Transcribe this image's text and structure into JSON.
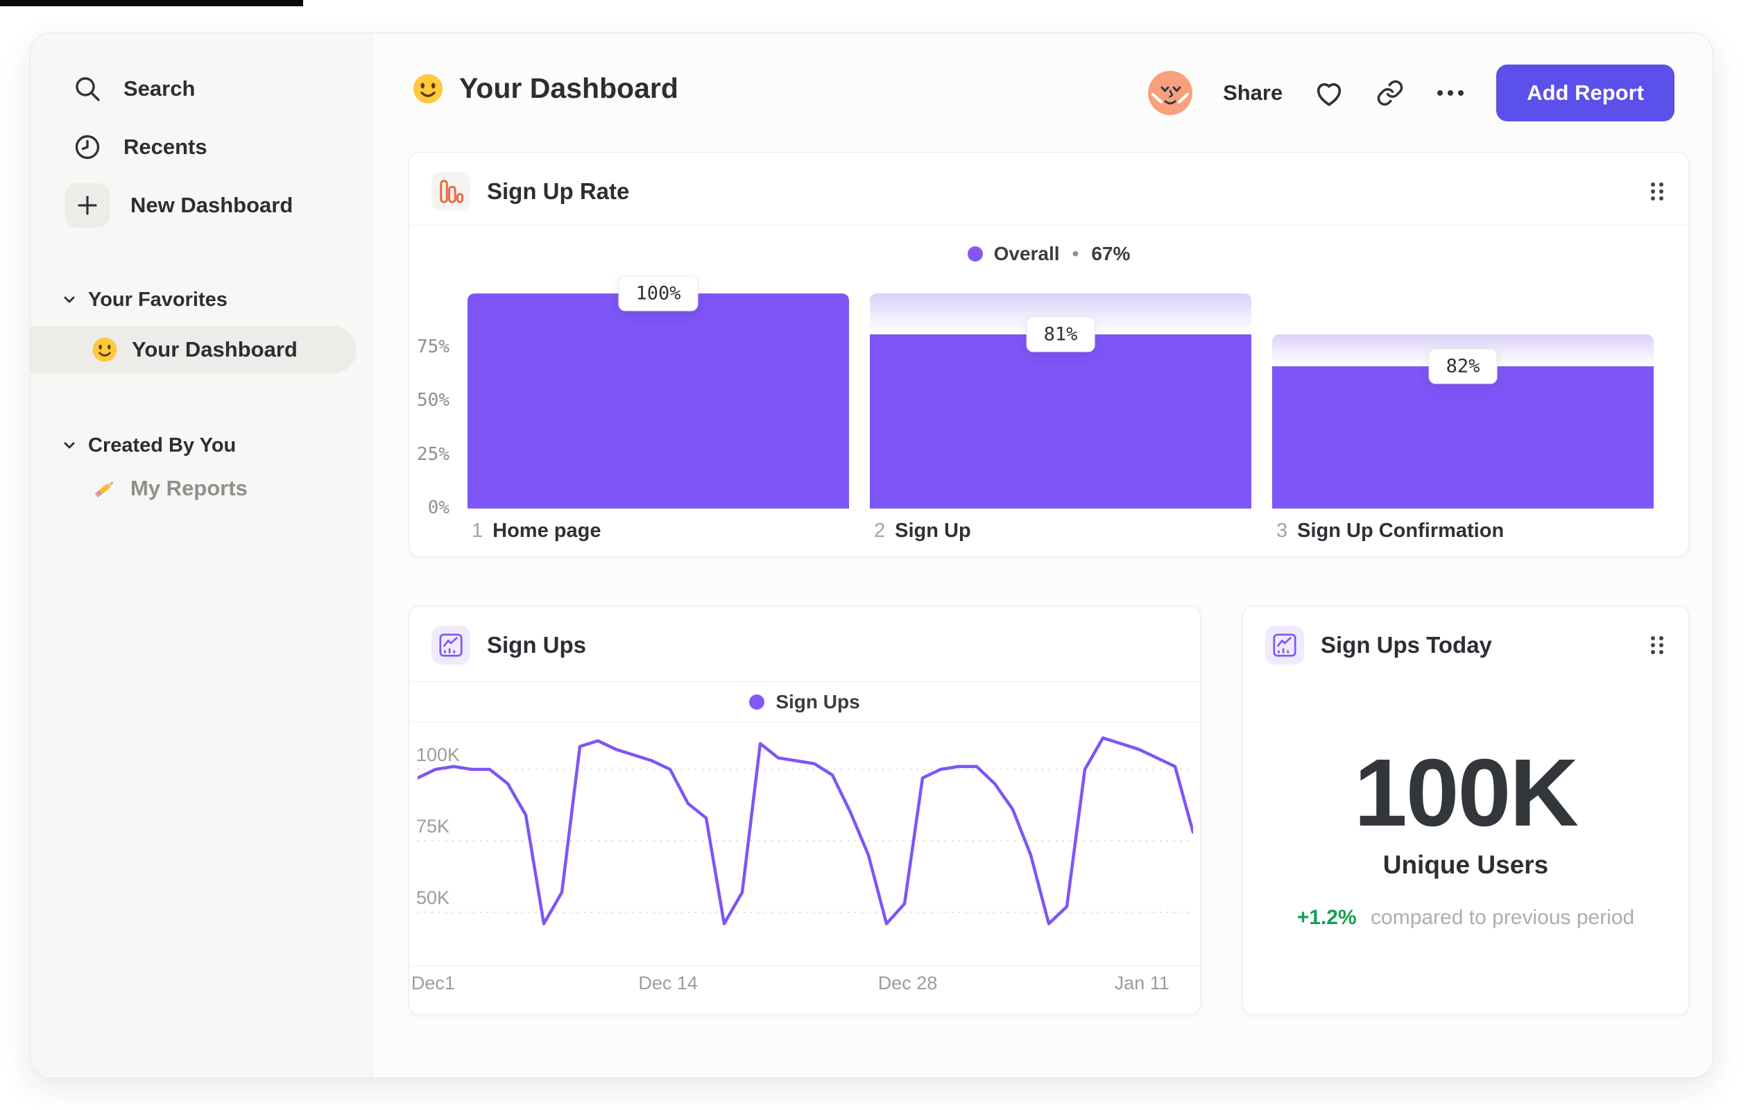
{
  "sidebar": {
    "items": [
      {
        "label": "Search"
      },
      {
        "label": "Recents"
      },
      {
        "label": "New Dashboard"
      }
    ],
    "sections": [
      {
        "title": "Your Favorites",
        "items": [
          {
            "label": "Your Dashboard",
            "active": true,
            "icon": "smiley-emoji"
          }
        ]
      },
      {
        "title": "Created By You",
        "items": [
          {
            "label": "My Reports",
            "active": false,
            "icon": "pencil-emoji"
          }
        ]
      }
    ]
  },
  "header": {
    "emoji": "smiley-emoji",
    "title": "Your Dashboard",
    "share_label": "Share",
    "add_report_label": "Add Report"
  },
  "funnel_card": {
    "title": "Sign Up Rate",
    "icon": "bar-chart-icon-orange",
    "legend": {
      "label": "Overall",
      "separator": "•",
      "value": "67%"
    },
    "y_ticks": [
      "75%",
      "50%",
      "25%",
      "0%"
    ],
    "steps": [
      {
        "index": "1",
        "label": "Home page",
        "value_label": "100%",
        "total_pct": 100,
        "solid_pct": 100
      },
      {
        "index": "2",
        "label": "Sign Up",
        "value_label": "81%",
        "total_pct": 100,
        "solid_pct": 81
      },
      {
        "index": "3",
        "label": "Sign Up Confirmation",
        "value_label": "82%",
        "total_pct": 81,
        "solid_pct": 66
      }
    ]
  },
  "line_card": {
    "title": "Sign Ups",
    "icon": "line-chart-icon-purple",
    "legend_label": "Sign Ups",
    "y_ticks": [
      {
        "label": "100K",
        "value": 100
      },
      {
        "label": "75K",
        "value": 75
      },
      {
        "label": "50K",
        "value": 50
      }
    ],
    "x_ticks": [
      {
        "label": "Dec1",
        "pos": 0.02
      },
      {
        "label": "Dec 14",
        "pos": 0.323
      },
      {
        "label": "Dec 28",
        "pos": 0.632
      },
      {
        "label": "Jan 11",
        "pos": 0.934
      }
    ],
    "values": [
      97,
      100,
      101,
      100,
      100,
      95,
      84,
      46,
      57,
      108,
      110,
      107,
      105,
      103,
      100,
      88,
      83,
      46,
      57,
      109,
      104,
      103,
      102,
      98,
      85,
      70,
      46,
      53,
      97,
      100,
      101,
      101,
      95,
      86,
      70,
      46,
      52,
      100,
      111,
      109,
      107,
      104,
      101,
      78
    ]
  },
  "today_card": {
    "title": "Sign Ups Today",
    "icon": "line-chart-icon-purple",
    "value": "100K",
    "label": "Unique Users",
    "delta": "+1.2%",
    "delta_text": "compared to previous period"
  },
  "colors": {
    "accent_purple": "#7E55F6",
    "legend_dot": "#8458F7",
    "button_purple": "#5B50E9",
    "delta_green": "#12A055",
    "funnel_icon_orange": "#ED6A45",
    "avatar_peach": "#F8A07B",
    "sidebar_bg": "#F7F7F5"
  },
  "chart_data": [
    {
      "type": "bar",
      "title": "Sign Up Rate",
      "legend": "Overall • 67%",
      "categories": [
        "1 Home page",
        "2 Sign Up",
        "3 Sign Up Confirmation"
      ],
      "values": [
        100,
        81,
        82
      ],
      "value_labels": [
        "100%",
        "81%",
        "82%"
      ],
      "overall_conversion_pct": 67,
      "y_ticks_pct": [
        0,
        25,
        50,
        75
      ],
      "notes": "funnel: solid bar = cumulative conversion (100, 81, 66 pct of users); light gradient cap = drop-off from previous step; tooltip shows step conversion"
    },
    {
      "type": "line",
      "title": "Sign Ups",
      "series": [
        {
          "name": "Sign Ups",
          "unit": "K",
          "values": [
            97,
            100,
            101,
            100,
            100,
            95,
            84,
            46,
            57,
            108,
            110,
            107,
            105,
            103,
            100,
            88,
            83,
            46,
            57,
            109,
            104,
            103,
            102,
            98,
            85,
            70,
            46,
            53,
            97,
            100,
            101,
            101,
            95,
            86,
            70,
            46,
            52,
            100,
            111,
            109,
            107,
            104,
            101,
            78
          ]
        }
      ],
      "x_ticks": [
        "Dec1",
        "Dec 14",
        "Dec 28",
        "Jan 11"
      ],
      "y_ticks": [
        "50K",
        "75K",
        "100K"
      ],
      "ylim": [
        40,
        115
      ],
      "grid": "dashed horizontal",
      "legend_position": "top-center"
    },
    {
      "type": "metric",
      "title": "Sign Ups Today",
      "value": "100K",
      "label": "Unique Users",
      "delta": "+1.2%",
      "comparison": "compared to previous period"
    }
  ]
}
